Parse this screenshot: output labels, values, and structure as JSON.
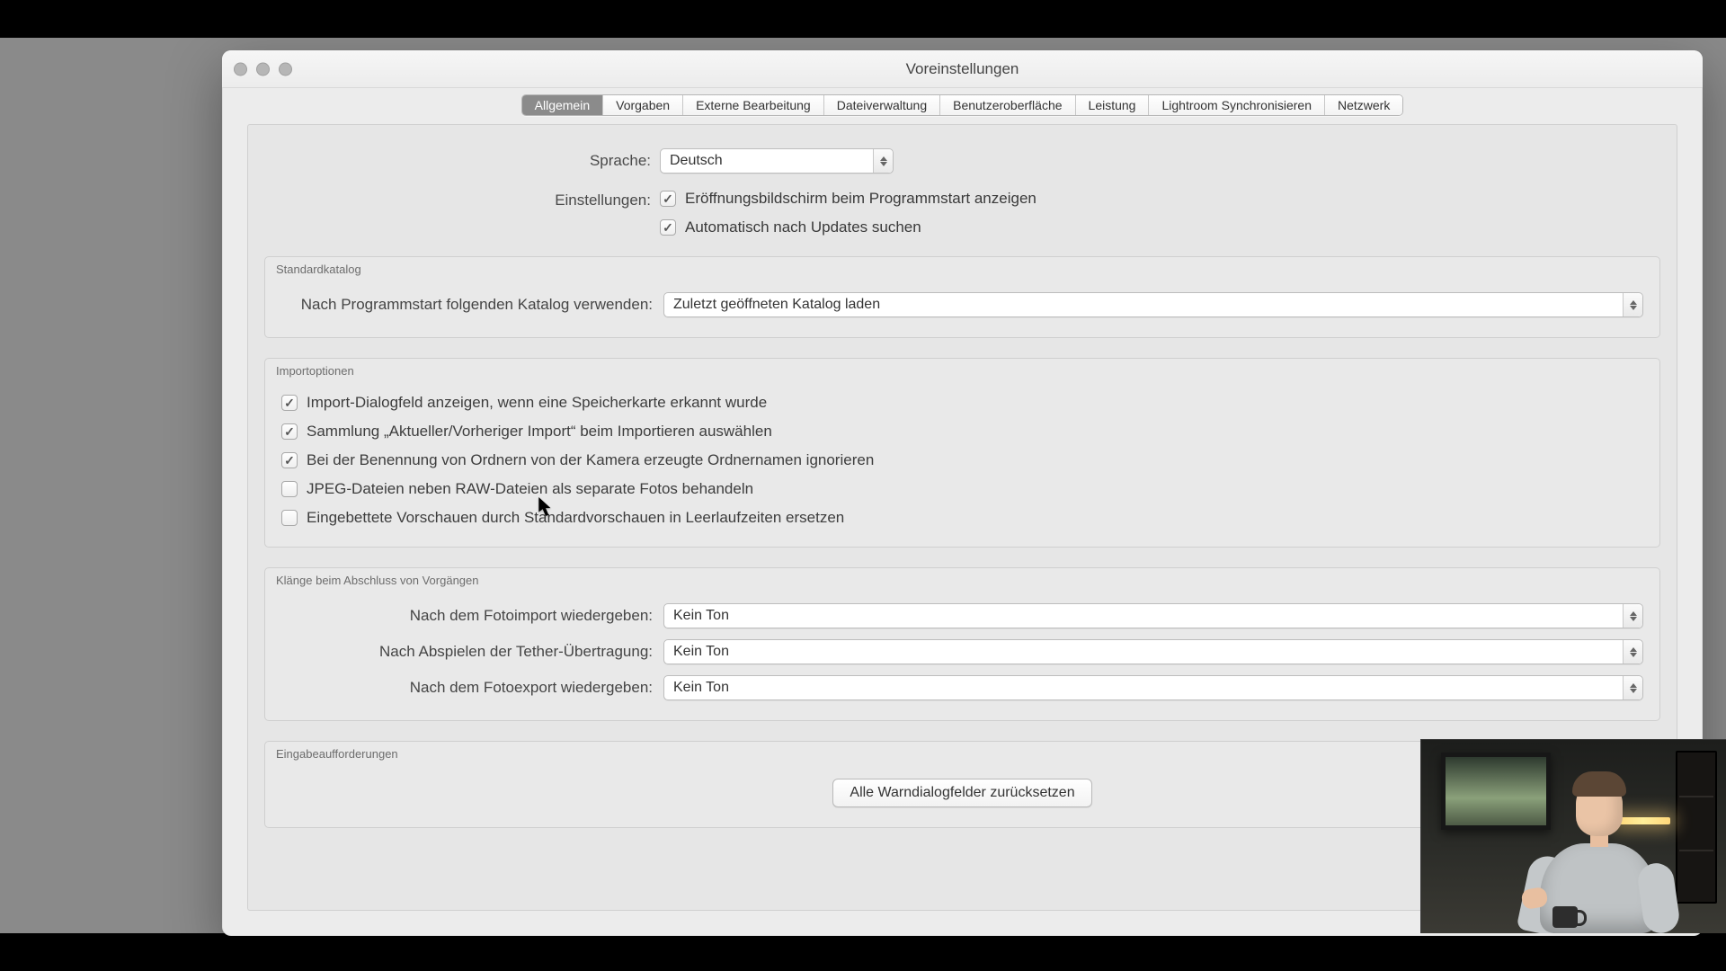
{
  "window": {
    "title": "Voreinstellungen"
  },
  "tabs": [
    {
      "label": "Allgemein",
      "active": true
    },
    {
      "label": "Vorgaben",
      "active": false
    },
    {
      "label": "Externe Bearbeitung",
      "active": false
    },
    {
      "label": "Dateiverwaltung",
      "active": false
    },
    {
      "label": "Benutzeroberfläche",
      "active": false
    },
    {
      "label": "Leistung",
      "active": false
    },
    {
      "label": "Lightroom Synchronisieren",
      "active": false
    },
    {
      "label": "Netzwerk",
      "active": false
    }
  ],
  "language": {
    "label": "Sprache:",
    "value": "Deutsch"
  },
  "settings": {
    "label": "Einstellungen:",
    "splash": {
      "checked": true,
      "text": "Eröffnungsbildschirm beim Programmstart anzeigen"
    },
    "updates": {
      "checked": true,
      "text": "Automatisch nach Updates suchen"
    }
  },
  "sections": {
    "default_catalog": {
      "title": "Standardkatalog",
      "row_label": "Nach Programmstart folgenden Katalog verwenden:",
      "value": "Zuletzt geöffneten Katalog laden"
    },
    "import": {
      "title": "Importoptionen",
      "opts": [
        {
          "checked": true,
          "text": "Import-Dialogfeld anzeigen, wenn eine Speicherkarte erkannt wurde"
        },
        {
          "checked": true,
          "text": "Sammlung „Aktueller/Vorheriger Import“ beim Importieren auswählen"
        },
        {
          "checked": true,
          "text": "Bei der Benennung von Ordnern von der Kamera erzeugte Ordnernamen ignorieren"
        },
        {
          "checked": false,
          "text": "JPEG-Dateien neben RAW-Dateien als separate Fotos behandeln"
        },
        {
          "checked": false,
          "text": "Eingebettete Vorschauen durch Standardvorschauen in Leerlaufzeiten ersetzen"
        }
      ]
    },
    "sounds": {
      "title": "Klänge beim Abschluss von Vorgängen",
      "rows": [
        {
          "label": "Nach dem Fotoimport wiedergeben:",
          "value": "Kein Ton"
        },
        {
          "label": "Nach Abspielen der Tether-Übertragung:",
          "value": "Kein Ton"
        },
        {
          "label": "Nach dem Fotoexport wiedergeben:",
          "value": "Kein Ton"
        }
      ]
    },
    "prompts": {
      "title": "Eingabeaufforderungen",
      "button": "Alle Warndialogfelder zurücksetzen"
    }
  }
}
